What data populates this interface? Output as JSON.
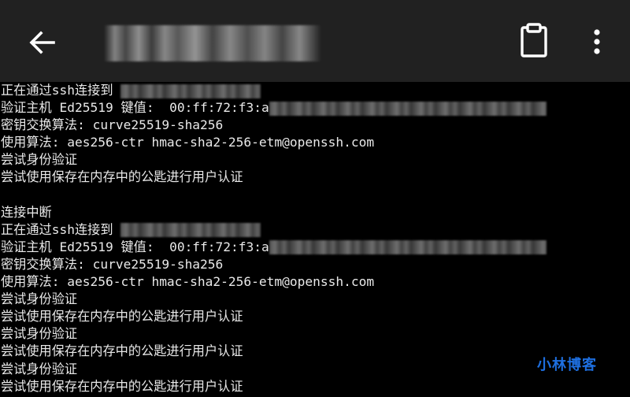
{
  "toolbar": {
    "back_icon": "arrow-left-icon",
    "title": "",
    "clipboard_icon": "clipboard-icon",
    "more_icon": "more-vertical-icon"
  },
  "colors": {
    "toolbar_bg": "#212121",
    "terminal_bg": "#000000",
    "terminal_text": "#e9e9e9",
    "watermark": "#1e6fe0"
  },
  "terminal": {
    "lines": [
      {
        "text": "正在通过ssh连接到 ",
        "redacted": true
      },
      {
        "text": "验证主机 Ed25519 键值:  00:ff:72:f3:a",
        "redacted": true
      },
      {
        "text": "密钥交换算法: curve25519-sha256",
        "redacted": false
      },
      {
        "text": "使用算法: aes256-ctr hmac-sha2-256-etm@openssh.com",
        "redacted": false
      },
      {
        "text": "尝试身份验证",
        "redacted": false
      },
      {
        "text": "尝试使用保存在内存中的公匙进行用户认证",
        "redacted": false
      },
      {
        "text": "",
        "redacted": false
      },
      {
        "text": "连接中断",
        "redacted": false
      },
      {
        "text": "正在通过ssh连接到 ",
        "redacted": true
      },
      {
        "text": "验证主机 Ed25519 键值:  00:ff:72:f3:a",
        "redacted": true
      },
      {
        "text": "密钥交换算法: curve25519-sha256",
        "redacted": false
      },
      {
        "text": "使用算法: aes256-ctr hmac-sha2-256-etm@openssh.com",
        "redacted": false
      },
      {
        "text": "尝试身份验证",
        "redacted": false
      },
      {
        "text": "尝试使用保存在内存中的公匙进行用户认证",
        "redacted": false
      },
      {
        "text": "尝试身份验证",
        "redacted": false
      },
      {
        "text": "尝试使用保存在内存中的公匙进行用户认证",
        "redacted": false
      },
      {
        "text": "尝试身份验证",
        "redacted": false
      },
      {
        "text": "尝试使用保存在内存中的公匙进行用户认证",
        "redacted": false
      }
    ]
  },
  "watermark": "小林博客"
}
